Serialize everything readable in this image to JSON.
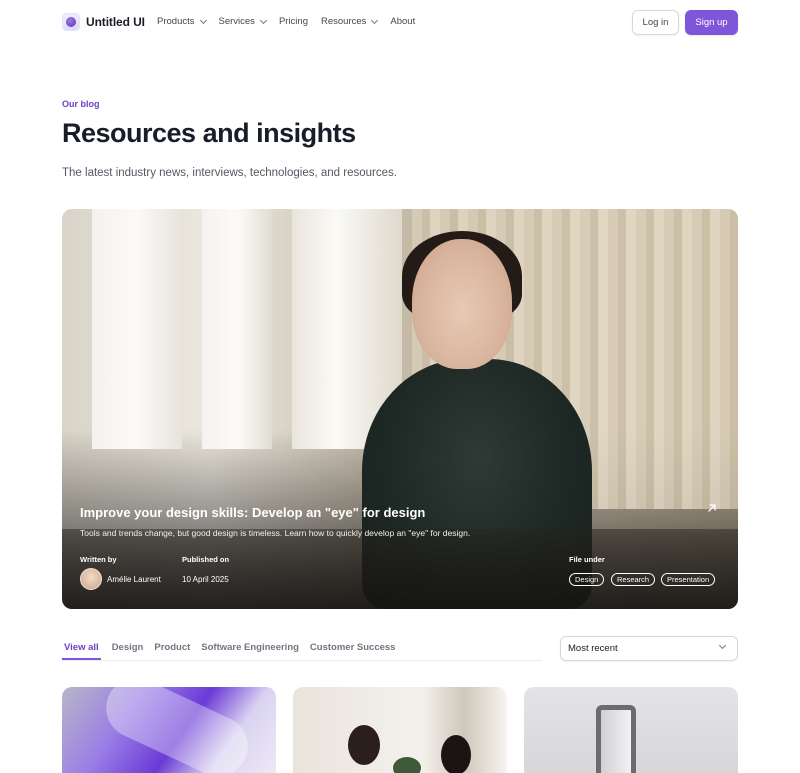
{
  "brand": {
    "name": "Untitled UI"
  },
  "nav": {
    "items": [
      {
        "label": "Products",
        "dropdown": true
      },
      {
        "label": "Services",
        "dropdown": true
      },
      {
        "label": "Pricing",
        "dropdown": false
      },
      {
        "label": "Resources",
        "dropdown": true
      },
      {
        "label": "About",
        "dropdown": false
      }
    ],
    "login_label": "Log in",
    "signup_label": "Sign up"
  },
  "header": {
    "eyebrow": "Our blog",
    "title": "Resources and insights",
    "subtitle": "The latest industry news, interviews, technologies, and resources."
  },
  "featured": {
    "title": "Improve your design skills: Develop an \"eye\" for design",
    "description": "Tools and trends change, but good design is timeless. Learn how to quickly develop an \"eye\" for design.",
    "written_by_label": "Written by",
    "author": "Amélie Laurent",
    "published_label": "Published on",
    "date": "10 April 2025",
    "file_under_label": "File under",
    "tags": [
      "Design",
      "Research",
      "Presentation"
    ]
  },
  "filters": {
    "tabs": [
      "View all",
      "Design",
      "Product",
      "Software Engineering",
      "Customer Success"
    ],
    "active_tab": "View all",
    "sort_selected": "Most recent"
  },
  "colors": {
    "accent": "#7f56d9",
    "accent_text": "#6941c6",
    "text_primary": "#181d27",
    "text_secondary": "#535862"
  }
}
